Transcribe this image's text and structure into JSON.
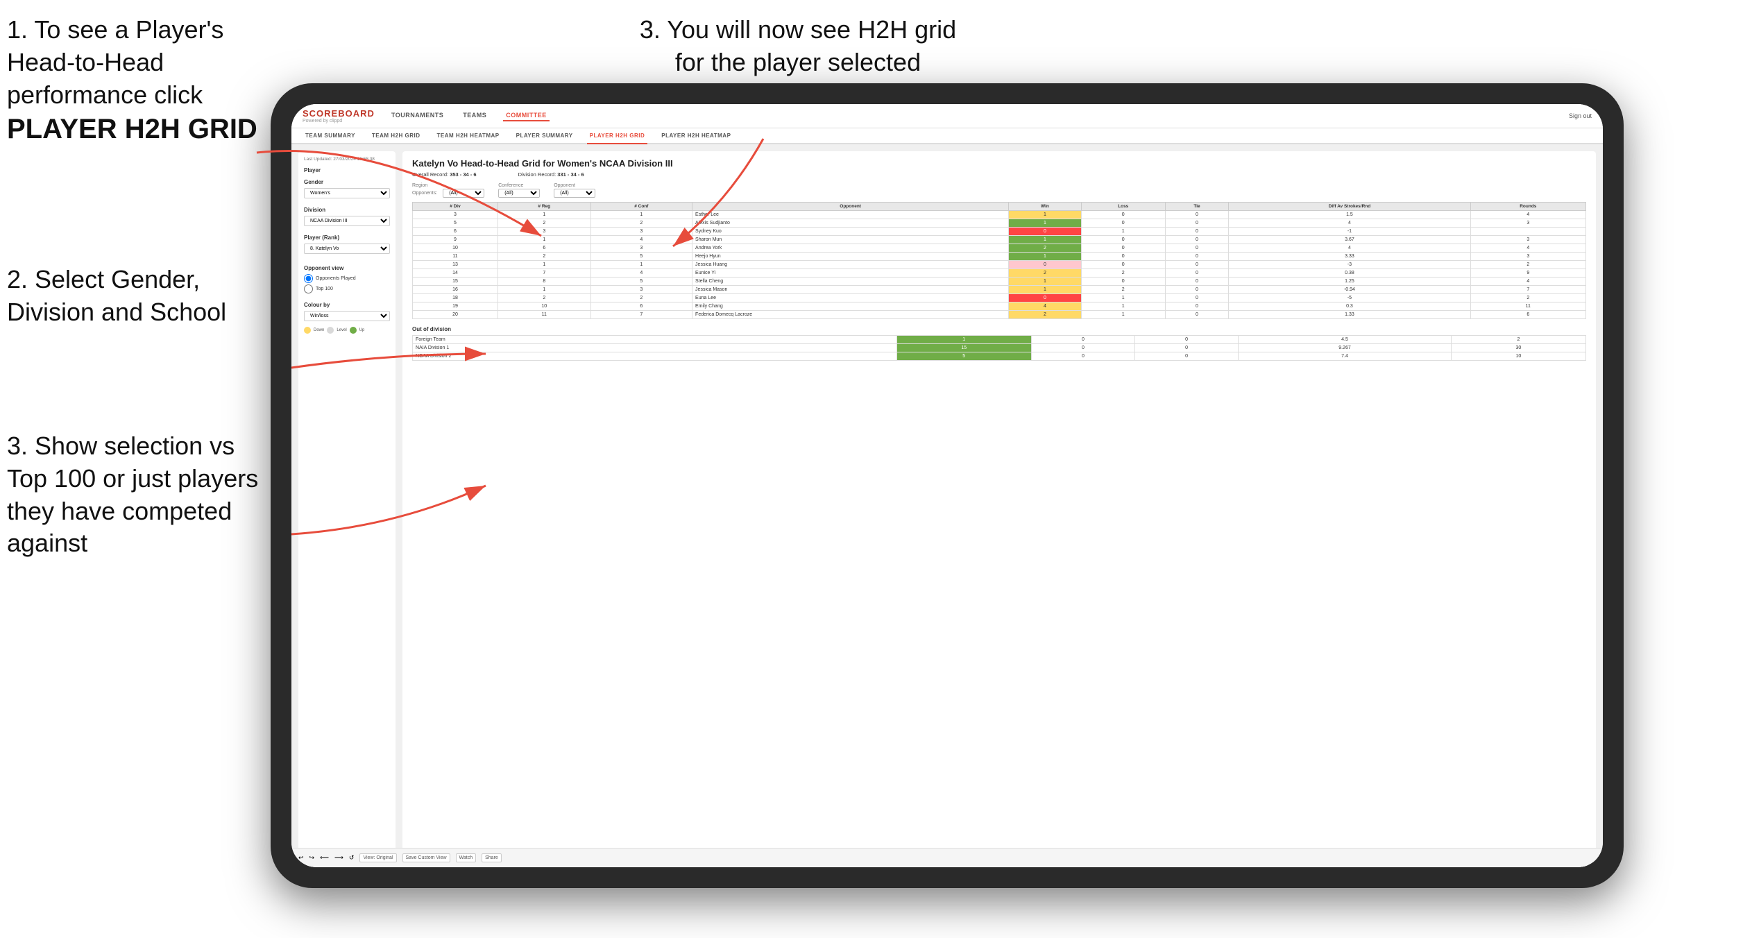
{
  "instructions": {
    "top_left_1": "1. To see a Player's Head-to-Head performance click",
    "top_left_bold": "PLAYER H2H GRID",
    "top_right": "3. You will now see H2H grid for the player selected",
    "mid_left": "2. Select Gender, Division and School",
    "bottom_left_3": "3. Show selection vs Top 100 or just players they have competed against"
  },
  "header": {
    "logo": "SCOREBOARD",
    "logo_sub": "Powered by clippd",
    "nav": [
      "TOURNAMENTS",
      "TEAMS",
      "COMMITTEE"
    ],
    "sign_out": "Sign out"
  },
  "sub_nav": {
    "items": [
      "TEAM SUMMARY",
      "TEAM H2H GRID",
      "TEAM H2H HEATMAP",
      "PLAYER SUMMARY",
      "PLAYER H2H GRID",
      "PLAYER H2H HEATMAP"
    ],
    "active": "PLAYER H2H GRID"
  },
  "sidebar": {
    "timestamp": "Last Updated: 27/03/2024 16:55:38",
    "player_label": "Player",
    "gender_label": "Gender",
    "gender_value": "Women's",
    "division_label": "Division",
    "division_value": "NCAA Division III",
    "player_rank_label": "Player (Rank)",
    "player_rank_value": "8. Katelyn Vo",
    "opponent_view_label": "Opponent view",
    "radio_played": "Opponents Played",
    "radio_top100": "Top 100",
    "colour_by_label": "Colour by",
    "colour_by_value": "Win/loss",
    "colour_down": "Down",
    "colour_level": "Level",
    "colour_up": "Up"
  },
  "grid": {
    "title": "Katelyn Vo Head-to-Head Grid for Women's NCAA Division III",
    "overall_record_label": "Overall Record:",
    "overall_record": "353 - 34 - 6",
    "division_record_label": "Division Record:",
    "division_record": "331 - 34 - 6",
    "region_label": "Region",
    "conference_label": "Conference",
    "opponent_label": "Opponent",
    "opponents_label": "Opponents:",
    "all_value": "(All)",
    "table_headers": [
      "# Div",
      "# Reg",
      "# Conf",
      "Opponent",
      "Win",
      "Loss",
      "Tie",
      "Diff Av Strokes/Rnd",
      "Rounds"
    ],
    "rows": [
      {
        "div": 3,
        "reg": 1,
        "conf": 1,
        "opponent": "Esther Lee",
        "win": 1,
        "loss": 0,
        "tie": 0,
        "diff": 1.5,
        "rounds": 4,
        "win_color": "win-yellow"
      },
      {
        "div": 5,
        "reg": 2,
        "conf": 2,
        "opponent": "Alexis Sudjianto",
        "win": 1,
        "loss": 0,
        "tie": 0,
        "diff": 4.0,
        "rounds": 3,
        "win_color": "win-green"
      },
      {
        "div": 6,
        "reg": 3,
        "conf": 3,
        "opponent": "Sydney Kuo",
        "win": 0,
        "loss": 1,
        "tie": 0,
        "diff": -1.0,
        "rounds": "",
        "win_color": "loss-red"
      },
      {
        "div": 9,
        "reg": 1,
        "conf": 4,
        "opponent": "Sharon Mun",
        "win": 1,
        "loss": 0,
        "tie": 0,
        "diff": 3.67,
        "rounds": 3,
        "win_color": "win-green"
      },
      {
        "div": 10,
        "reg": 6,
        "conf": 3,
        "opponent": "Andrea York",
        "win": 2,
        "loss": 0,
        "tie": 0,
        "diff": 4.0,
        "rounds": 4,
        "win_color": "win-green"
      },
      {
        "div": 11,
        "reg": 2,
        "conf": 5,
        "opponent": "Heejo Hyun",
        "win": 1,
        "loss": 0,
        "tie": 0,
        "diff": 3.33,
        "rounds": 3,
        "win_color": "win-green"
      },
      {
        "div": 13,
        "reg": 1,
        "conf": 1,
        "opponent": "Jessica Huang",
        "win": 0,
        "loss": 0,
        "tie": 0,
        "diff": -3.0,
        "rounds": 2,
        "win_color": "loss-light"
      },
      {
        "div": 14,
        "reg": 7,
        "conf": 4,
        "opponent": "Eunice Yi",
        "win": 2,
        "loss": 2,
        "tie": 0,
        "diff": 0.38,
        "rounds": 9,
        "win_color": "win-yellow"
      },
      {
        "div": 15,
        "reg": 8,
        "conf": 5,
        "opponent": "Stella Cheng",
        "win": 1,
        "loss": 0,
        "tie": 0,
        "diff": 1.25,
        "rounds": 4,
        "win_color": "win-yellow"
      },
      {
        "div": 16,
        "reg": 1,
        "conf": 3,
        "opponent": "Jessica Mason",
        "win": 1,
        "loss": 2,
        "tie": 0,
        "diff": -0.94,
        "rounds": 7,
        "win_color": "win-yellow"
      },
      {
        "div": 18,
        "reg": 2,
        "conf": 2,
        "opponent": "Euna Lee",
        "win": 0,
        "loss": 1,
        "tie": 0,
        "diff": -5.0,
        "rounds": 2,
        "win_color": "loss-red"
      },
      {
        "div": 19,
        "reg": 10,
        "conf": 6,
        "opponent": "Emily Chang",
        "win": 4,
        "loss": 1,
        "tie": 0,
        "diff": 0.3,
        "rounds": 11,
        "win_color": "win-yellow"
      },
      {
        "div": 20,
        "reg": 11,
        "conf": 7,
        "opponent": "Federica Domecq Lacroze",
        "win": 2,
        "loss": 1,
        "tie": 0,
        "diff": 1.33,
        "rounds": 6,
        "win_color": "win-yellow"
      }
    ],
    "out_of_division_label": "Out of division",
    "out_of_division_rows": [
      {
        "team": "Foreign Team",
        "win": 1,
        "loss": 0,
        "tie": 0,
        "diff": 4.5,
        "rounds": 2
      },
      {
        "team": "NAIA Division 1",
        "win": 15,
        "loss": 0,
        "tie": 0,
        "diff": 9.267,
        "rounds": 30
      },
      {
        "team": "NCAA Division 2",
        "win": 5,
        "loss": 0,
        "tie": 0,
        "diff": 7.4,
        "rounds": 10
      }
    ]
  },
  "toolbar": {
    "view_original": "View: Original",
    "save_custom": "Save Custom View",
    "watch": "Watch",
    "share": "Share"
  }
}
